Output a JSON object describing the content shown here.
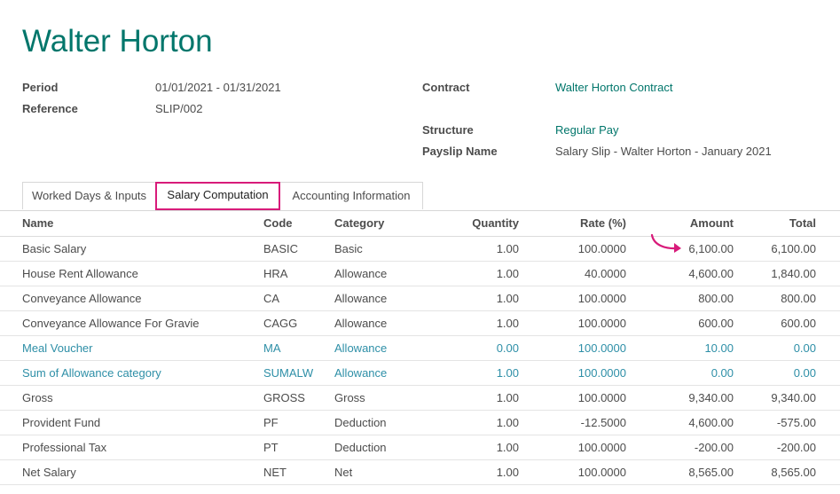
{
  "header": {
    "title": "Walter Horton"
  },
  "fields": {
    "period_label": "Period",
    "period_value": "01/01/2021 - 01/31/2021",
    "reference_label": "Reference",
    "reference_value": "SLIP/002",
    "contract_label": "Contract",
    "contract_value": "Walter Horton Contract",
    "structure_label": "Structure",
    "structure_value": "Regular Pay",
    "payslip_name_label": "Payslip Name",
    "payslip_name_value": "Salary Slip - Walter Horton - January 2021"
  },
  "tabs": [
    {
      "label": "Worked Days & Inputs",
      "active": false
    },
    {
      "label": "Salary Computation",
      "active": true
    },
    {
      "label": "Accounting Information",
      "active": false
    }
  ],
  "table": {
    "columns": [
      "Name",
      "Code",
      "Category",
      "Quantity",
      "Rate (%)",
      "Amount",
      "Total"
    ],
    "rows": [
      [
        "Basic Salary",
        "BASIC",
        "Basic",
        "1.00",
        "100.0000",
        "6,100.00",
        "6,100.00"
      ],
      [
        "House Rent Allowance",
        "HRA",
        "Allowance",
        "1.00",
        "40.0000",
        "4,600.00",
        "1,840.00"
      ],
      [
        "Conveyance Allowance",
        "CA",
        "Allowance",
        "1.00",
        "100.0000",
        "800.00",
        "800.00"
      ],
      [
        "Conveyance Allowance For Gravie",
        "CAGG",
        "Allowance",
        "1.00",
        "100.0000",
        "600.00",
        "600.00"
      ],
      [
        "Meal Voucher",
        "MA",
        "Allowance",
        "0.00",
        "100.0000",
        "10.00",
        "0.00"
      ],
      [
        "Sum of Allowance category",
        "SUMALW",
        "Allowance",
        "1.00",
        "100.0000",
        "0.00",
        "0.00"
      ],
      [
        "Gross",
        "GROSS",
        "Gross",
        "1.00",
        "100.0000",
        "9,340.00",
        "9,340.00"
      ],
      [
        "Provident Fund",
        "PF",
        "Deduction",
        "1.00",
        "-12.5000",
        "4,600.00",
        "-575.00"
      ],
      [
        "Professional Tax",
        "PT",
        "Deduction",
        "1.00",
        "100.0000",
        "-200.00",
        "-200.00"
      ],
      [
        "Net Salary",
        "NET",
        "Net",
        "1.00",
        "100.0000",
        "8,565.00",
        "8,565.00"
      ]
    ],
    "muted_rows": [
      4,
      5
    ]
  },
  "colors": {
    "title": "#01766b",
    "link": "#01766b",
    "muted_row": "#2e8fa7",
    "tab_highlight": "#d81b7a",
    "annotation_arrow": "#d81b7a"
  },
  "icons": {
    "annotation": "curved-arrow-icon"
  }
}
